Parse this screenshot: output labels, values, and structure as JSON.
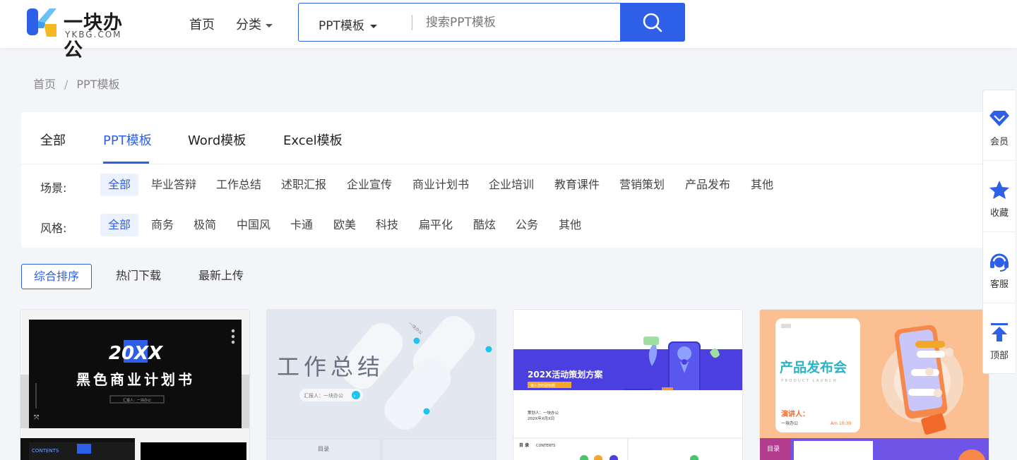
{
  "colors": {
    "accent": "#2d5fe8",
    "accent_light": "#ebf1fd"
  },
  "logo": {
    "name": "一块办公",
    "sub": "YKBG.COM"
  },
  "nav": {
    "home": "首页",
    "category": "分类"
  },
  "search": {
    "type": "PPT模板",
    "placeholder": "搜索PPT模板",
    "icon": "search-icon"
  },
  "breadcrumb": {
    "home": "首页",
    "separator": "/",
    "current": "PPT模板"
  },
  "tabs": [
    "全部",
    "PPT模板",
    "Word模板",
    "Excel模板"
  ],
  "filters": {
    "scene": {
      "label": "场景:",
      "options": [
        "全部",
        "毕业答辩",
        "工作总结",
        "述职汇报",
        "企业宣传",
        "商业计划书",
        "企业培训",
        "教育课件",
        "营销策划",
        "产品发布",
        "其他"
      ]
    },
    "style": {
      "label": "风格:",
      "options": [
        "全部",
        "商务",
        "极简",
        "中国风",
        "卡通",
        "欧美",
        "科技",
        "扁平化",
        "酷炫",
        "公务",
        "其他"
      ]
    }
  },
  "sort": [
    "综合排序",
    "热门下载",
    "最新上传"
  ],
  "cards": [
    {
      "headline": "20XX",
      "title": "黑色商业计划书",
      "sub": "汇报人：一块办公",
      "contents": "CONTENTS"
    },
    {
      "title": "工作总结",
      "reporter": "汇报人：一块办公",
      "toc": "目录",
      "tag": "一块办公"
    },
    {
      "title": "202X活动策划方案",
      "sub": "输入您的副标题",
      "meta1": "策划人：一块办公",
      "meta2": "202X年X月X日",
      "toc": "目 录",
      "toc_en": "CONTENTS"
    },
    {
      "title": "产品发布会",
      "sub": "PRODUCT LAUNCH",
      "speaker": "演讲人：",
      "speaker_name": "一块办公",
      "time": "Am 10:30",
      "toc": "目录"
    }
  ],
  "sidebar": [
    {
      "label": "会员",
      "icon": "diamond-icon"
    },
    {
      "label": "收藏",
      "icon": "star-icon"
    },
    {
      "label": "客服",
      "icon": "headset-icon"
    },
    {
      "label": "顶部",
      "icon": "to-top-icon"
    }
  ]
}
